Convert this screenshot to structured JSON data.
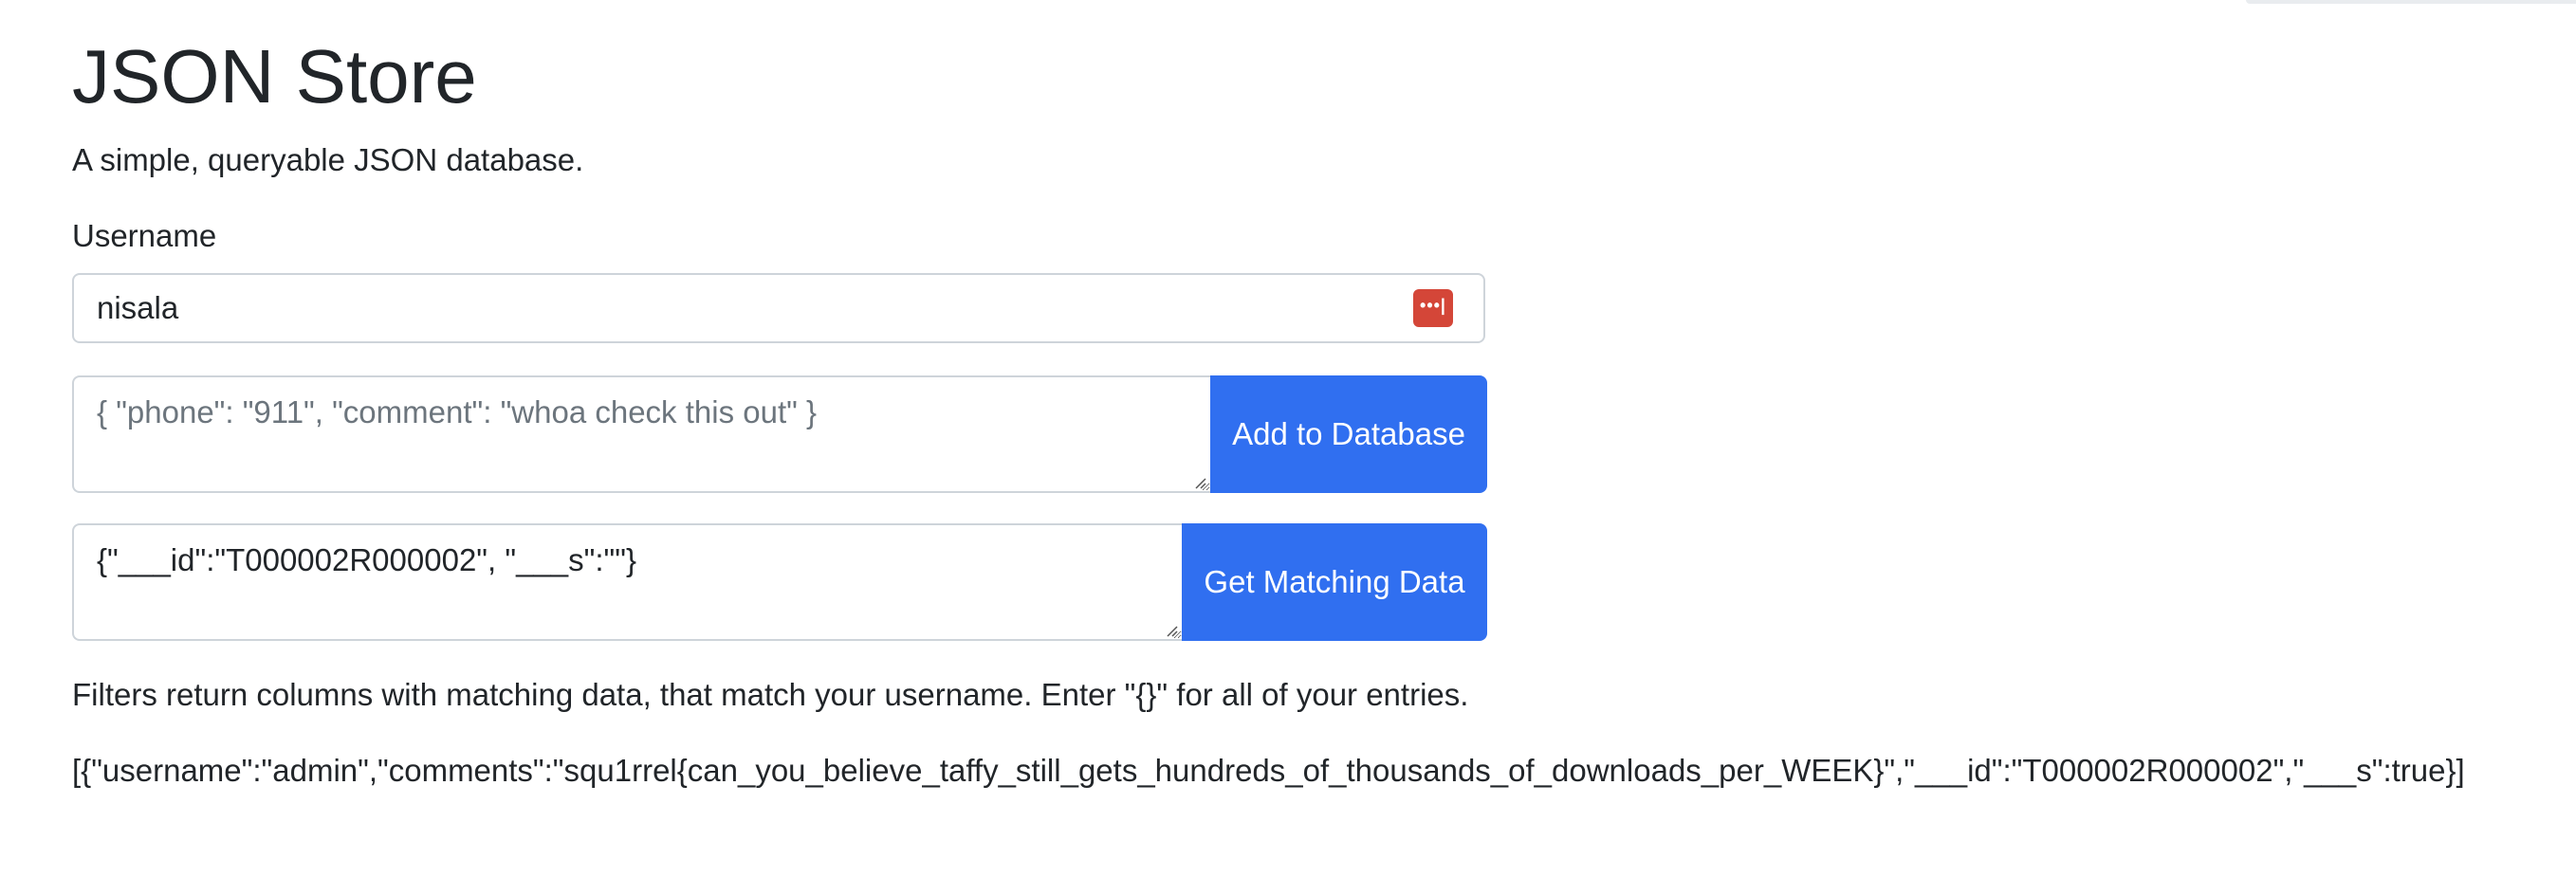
{
  "page": {
    "title": "JSON Store",
    "subtitle": "A simple, queryable JSON database."
  },
  "username": {
    "label": "Username",
    "value": "nisala",
    "password_manager_icon": "password-manager-icon",
    "password_manager_icon_color": "#d44638"
  },
  "add_form": {
    "placeholder": "{ \"phone\": \"911\", \"comment\": \"whoa check this out\" }",
    "value": "",
    "button_label": "Add to Database"
  },
  "query_form": {
    "value": "{\"___id\":\"T000002R000002\", \"___s\":\"\"}",
    "button_label": "Get Matching Data"
  },
  "help_text": "Filters return columns with matching data, that match your username. Enter \"{}\" for all of your entries.",
  "result_text": "[{\"username\":\"admin\",\"comments\":\"squ1rrel{can_you_believe_taffy_still_gets_hundreds_of_thousands_of_downloads_per_WEEK}\",\"___id\":\"T000002R000002\",\"___s\":true}]",
  "colors": {
    "primary_button": "#306ff0",
    "text": "#212529",
    "border": "#ced4da",
    "placeholder": "#6c757d"
  }
}
